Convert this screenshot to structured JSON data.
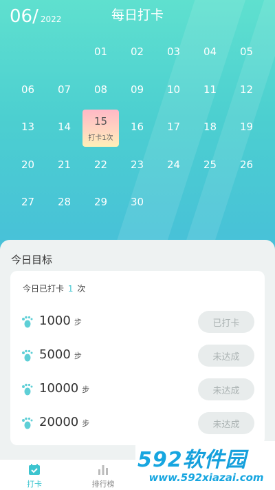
{
  "header": {
    "month": "06/",
    "year": "2022",
    "title": "每日打卡"
  },
  "calendar": {
    "days": [
      "",
      "",
      "01",
      "02",
      "03",
      "04",
      "05",
      "06",
      "07",
      "08",
      "09",
      "10",
      "11",
      "12",
      "13",
      "14",
      "15",
      "16",
      "17",
      "18",
      "19",
      "20",
      "21",
      "22",
      "23",
      "24",
      "25",
      "26",
      "27",
      "28",
      "29",
      "30"
    ],
    "marked_day": "15",
    "marked_label": "打卡1次"
  },
  "goals": {
    "section_title": "今日目标",
    "count_prefix": "今日已打卡",
    "count_value": "1",
    "count_suffix": "次",
    "unit": "步",
    "items": [
      {
        "steps": "1000",
        "status": "已打卡"
      },
      {
        "steps": "5000",
        "status": "未达成"
      },
      {
        "steps": "10000",
        "status": "未达成"
      },
      {
        "steps": "20000",
        "status": "未达成"
      }
    ]
  },
  "tabs": [
    {
      "label": "打卡",
      "icon": "calendar-check-icon"
    },
    {
      "label": "排行榜",
      "icon": "bar-chart-icon"
    }
  ],
  "watermark": {
    "brand_num": "592",
    "brand_text": "软件园",
    "url": "www.592xiazai.com"
  },
  "colors": {
    "accent": "#3cc4cf",
    "hero_top": "#5fe0cf",
    "hero_bottom": "#47bfd9"
  }
}
